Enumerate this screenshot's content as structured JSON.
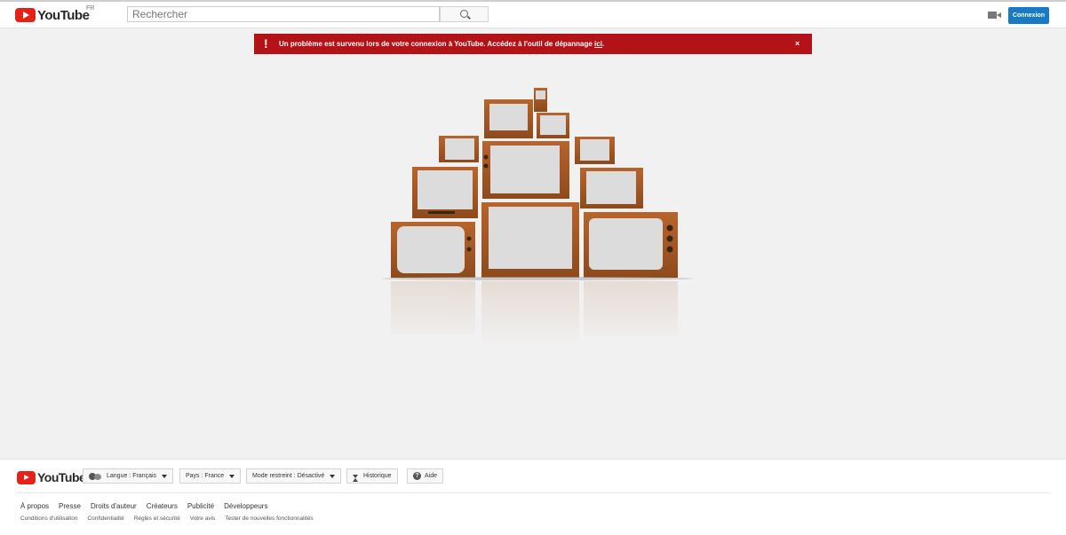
{
  "header": {
    "logo_text": "YouTube",
    "country_code": "FR",
    "search_placeholder": "Rechercher",
    "search_icon": "search-icon",
    "upload_icon": "video-camera-icon",
    "signin_label": "Connexion",
    "signin_color": "#167ac6"
  },
  "alert": {
    "icon": "!",
    "message": "Un problème est survenu lors de votre connexion à YouTube. Accédez à l'outil de dépannage ",
    "link_text": "ici",
    "end": ".",
    "close_label": "×",
    "color": "#b31217"
  },
  "footer": {
    "logo_text": "YouTube",
    "language_label": "Langue : Français",
    "country_label": "Pays : France",
    "restricted_label": "Mode restreint : Désactivé",
    "history_label": "Historique",
    "help_label": "Aide",
    "primary_links": [
      "À propos",
      "Presse",
      "Droits d'auteur",
      "Créateurs",
      "Publicité",
      "Développeurs"
    ],
    "secondary_links": [
      "Conditions d'utilisation",
      "Confidentialité",
      "Règles et sécurité",
      "Votre avis",
      "Tester de nouvelles fonctionnalités"
    ]
  }
}
